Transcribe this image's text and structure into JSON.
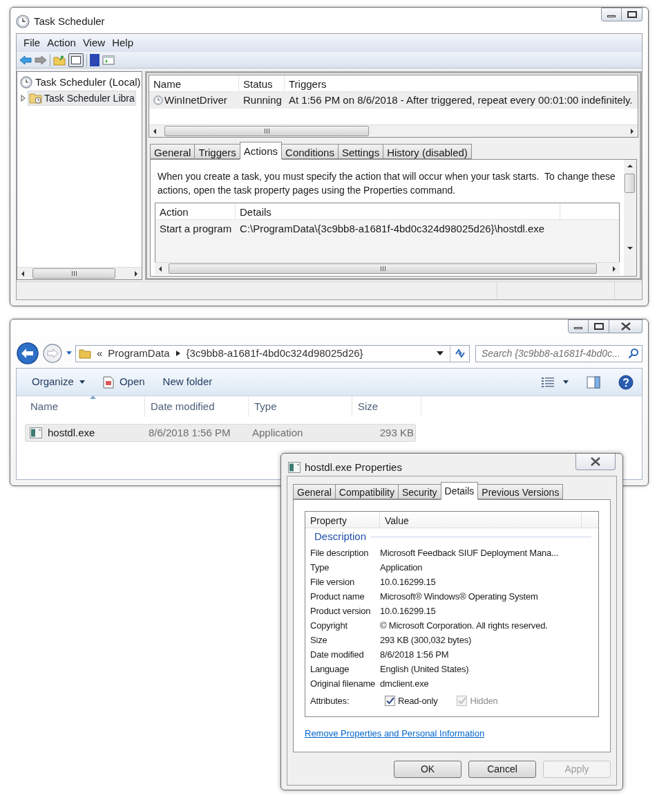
{
  "task_scheduler": {
    "title": "Task Scheduler",
    "menu": [
      "File",
      "Action",
      "View",
      "Help"
    ],
    "tree": [
      {
        "label": "Task Scheduler (Local)",
        "children": [
          {
            "label": "Task Scheduler Libra",
            "selected": true,
            "expanded": false
          }
        ]
      }
    ],
    "task_list": {
      "columns": [
        "Name",
        "Status",
        "Triggers"
      ],
      "rows": [
        {
          "name": "WinInetDriver",
          "status": "Running",
          "triggers": "At 1:56 PM on 8/6/2018 - After triggered, repeat every 00:01:00 indefinitely.",
          "selected": true
        }
      ]
    },
    "tabs": [
      {
        "label": "General",
        "selected": false
      },
      {
        "label": "Triggers",
        "selected": false
      },
      {
        "label": "Actions",
        "selected": true
      },
      {
        "label": "Conditions",
        "selected": false
      },
      {
        "label": "Settings",
        "selected": false
      },
      {
        "label": "History (disabled)",
        "selected": false
      }
    ],
    "actions_description": "When you create a task, you must specify the action that will occur when your task starts.  To change these actions, open the task property pages using the Properties command.",
    "actions_table": {
      "columns": [
        "Action",
        "Details"
      ],
      "rows": [
        {
          "action": "Start a program",
          "details": "C:\\ProgramData\\{3c9bb8-a1681f-4bd0c324d98025d26}\\hostdl.exe"
        }
      ]
    }
  },
  "explorer": {
    "breadcrumb_overflow": "«",
    "breadcrumb": [
      "ProgramData",
      "{3c9bb8-a1681f-4bd0c324d98025d26}"
    ],
    "search": {
      "placeholder": "Search {3c9bb8-a1681f-4bd0c..."
    },
    "toolbar": [
      {
        "label": "Organize",
        "kind": "menu"
      },
      {
        "label": "Open",
        "kind": "icon"
      },
      {
        "label": "New folder",
        "kind": "plain"
      }
    ],
    "columns": [
      "Name",
      "Date modified",
      "Type",
      "Size"
    ],
    "files": [
      {
        "name": "hostdl.exe",
        "date_modified": "8/6/2018 1:56 PM",
        "type": "Application",
        "size": "293 KB",
        "selected": true
      }
    ]
  },
  "properties_dialog": {
    "title": "hostdl.exe Properties",
    "tabs": [
      {
        "label": "General",
        "selected": false
      },
      {
        "label": "Compatibility",
        "selected": false
      },
      {
        "label": "Security",
        "selected": false
      },
      {
        "label": "Details",
        "selected": true
      },
      {
        "label": "Previous Versions",
        "selected": false
      }
    ],
    "columns": [
      "Property",
      "Value"
    ],
    "group": "Description",
    "rows": [
      {
        "property": "File description",
        "value": "Microsoft Feedback SIUF Deployment Mana..."
      },
      {
        "property": "Type",
        "value": "Application"
      },
      {
        "property": "File version",
        "value": "10.0.16299.15"
      },
      {
        "property": "Product name",
        "value": "Microsoft® Windows® Operating System"
      },
      {
        "property": "Product version",
        "value": "10.0.16299.15"
      },
      {
        "property": "Copyright",
        "value": "© Microsoft Corporation. All rights reserved."
      },
      {
        "property": "Size",
        "value": "293 KB (300,032 bytes)"
      },
      {
        "property": "Date modified",
        "value": "8/6/2018 1:56 PM"
      },
      {
        "property": "Language",
        "value": "English (United States)"
      },
      {
        "property": "Original filename",
        "value": "dmclient.exe"
      }
    ],
    "attributes_label": "Attributes:",
    "attributes": [
      {
        "label": "Read-only",
        "checked": true,
        "disabled": false
      },
      {
        "label": "Hidden",
        "checked": true,
        "disabled": true
      }
    ],
    "link": "Remove Properties and Personal Information",
    "buttons": [
      {
        "label": "OK",
        "disabled": false
      },
      {
        "label": "Cancel",
        "disabled": false
      },
      {
        "label": "Apply",
        "disabled": true
      }
    ]
  }
}
